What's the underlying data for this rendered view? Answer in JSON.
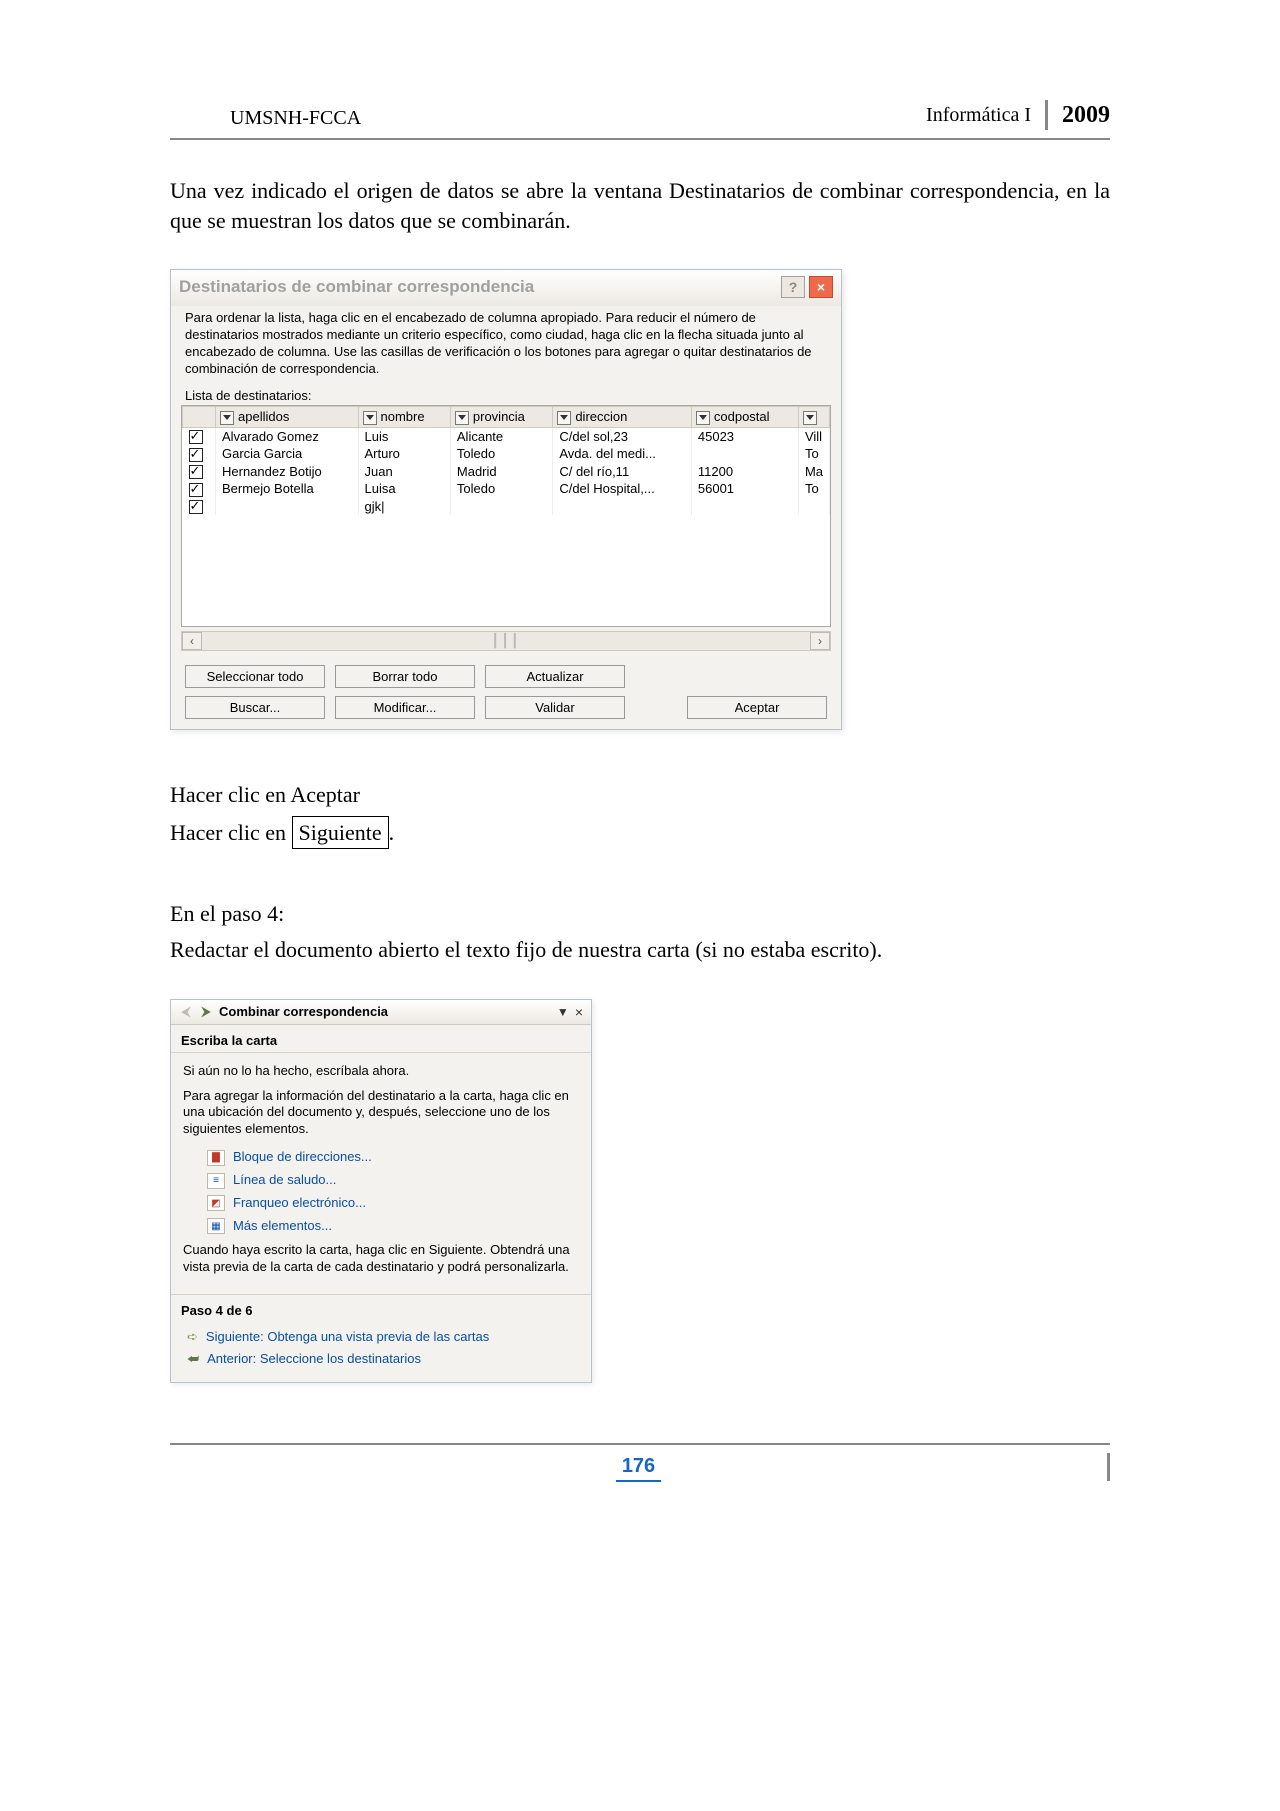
{
  "header": {
    "left": "UMSNH-FCCA",
    "right_label": "Informática I",
    "year": "2009"
  },
  "para_intro": "Una vez indicado el origen de datos se abre la ventana Destinatarios de combinar correspondencia, en la que se muestran los datos que se combinarán.",
  "dialog1": {
    "title": "Destinatarios de combinar correspondencia",
    "help_icon": "?",
    "close_icon": "×",
    "description": "Para ordenar la lista, haga clic en el encabezado de columna apropiado. Para reducir el número de destinatarios mostrados mediante un criterio específico, como ciudad, haga clic en la flecha situada junto al encabezado de columna. Use las casillas de verificación o los botones para agregar o quitar destinatarios de combinación de correspondencia.",
    "list_label": "Lista de destinatarios:",
    "columns": [
      "apellidos",
      "nombre",
      "provincia",
      "direccion",
      "codpostal",
      ""
    ],
    "col_last_overflow": [
      "Vill",
      "To",
      "Ma",
      "To"
    ],
    "rows": [
      {
        "checked": true,
        "apellidos": "Alvarado Gomez",
        "nombre": "Luis",
        "provincia": "Alicante",
        "direccion": "C/del sol,23",
        "codpostal": "45023"
      },
      {
        "checked": true,
        "apellidos": "Garcia Garcia",
        "nombre": "Arturo",
        "provincia": "Toledo",
        "direccion": "Avda. del medi...",
        "codpostal": ""
      },
      {
        "checked": true,
        "apellidos": "Hernandez Botijo",
        "nombre": "Juan",
        "provincia": "Madrid",
        "direccion": "C/ del río,11",
        "codpostal": "11200"
      },
      {
        "checked": true,
        "apellidos": "Bermejo Botella",
        "nombre": "Luisa",
        "provincia": "Toledo",
        "direccion": "C/del Hospital,...",
        "codpostal": "56001"
      },
      {
        "checked": true,
        "apellidos": "",
        "nombre": "gjk|",
        "provincia": "",
        "direccion": "",
        "codpostal": ""
      }
    ],
    "buttons_row1": [
      "Seleccionar todo",
      "Borrar todo",
      "Actualizar"
    ],
    "buttons_row2": [
      "Buscar...",
      "Modificar...",
      "Validar"
    ],
    "accept": "Aceptar"
  },
  "after_dialog": {
    "line1": "Hacer clic en Aceptar",
    "line2a": "Hacer clic en ",
    "line2b_box": "Siguiente",
    "line2c": "."
  },
  "step4": {
    "heading": "En el paso 4:",
    "desc": "Redactar el documento abierto el texto fijo de nuestra carta (si no estaba escrito)."
  },
  "panel2": {
    "title": "Combinar correspondencia",
    "section_heading": "Escriba la carta",
    "p1": "Si aún no lo ha hecho, escríbala ahora.",
    "p2": "Para agregar la información del destinatario a la carta, haga clic en una ubicación del documento y, después, seleccione uno de los siguientes elementos.",
    "links": [
      "Bloque de direcciones...",
      "Línea de saludo...",
      "Franqueo electrónico...",
      "Más elementos..."
    ],
    "p3": "Cuando haya escrito la carta, haga clic en Siguiente. Obtendrá una vista previa de la carta de cada destinatario y podrá personalizarla.",
    "step_heading": "Paso 4 de 6",
    "next": "Siguiente: Obtenga una vista previa de las cartas",
    "prev": "Anterior: Seleccione los destinatarios"
  },
  "footer": {
    "page_number": "176"
  }
}
